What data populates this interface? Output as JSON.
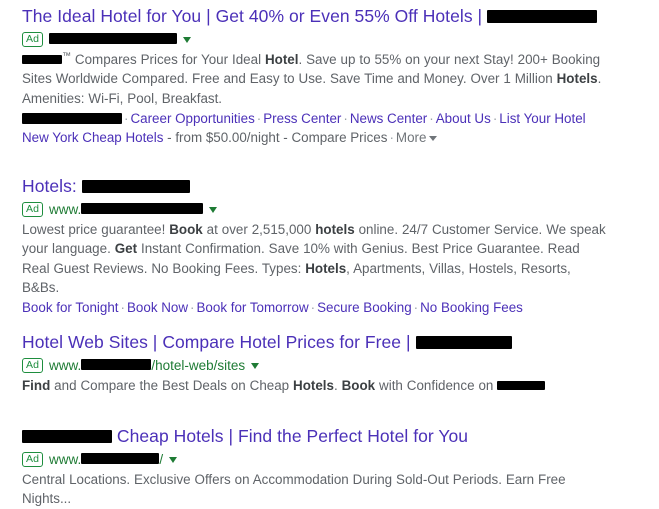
{
  "page": {
    "background": "#ffffff",
    "title_color": "#4b30b8",
    "url_color": "#1e7b34",
    "desc_color": "#5f6368",
    "ad_badge_color": "#1e8e3e",
    "separator_color": "#9aa0a6",
    "redaction_color": "#000000"
  },
  "ads": [
    {
      "badge": "Ad",
      "title_before": "The Ideal Hotel for You | Get 40% or Even 55% Off Hotels | ",
      "title_redacted_width": 110,
      "title_after": "",
      "url_prefix": "",
      "url_redacted_width": 128,
      "url_suffix": "",
      "has_caret": true,
      "desc_redacted_width": 40,
      "desc_trademark": "™",
      "desc_parts": [
        {
          "text": " Compares Prices for Your Ideal ",
          "bold": false
        },
        {
          "text": "Hotel",
          "bold": true
        },
        {
          "text": ". Save up to 55% on your next Stay! 200+ Booking Sites Worldwide Compared. Free and Easy to Use. Save Time and Money. Over 1 Million ",
          "bold": false
        },
        {
          "text": "Hotels",
          "bold": true
        },
        {
          "text": ". Amenities: Wi-Fi, Pool, Breakfast.",
          "bold": false
        }
      ],
      "sitelinks_row1_redacted_width": 100,
      "sitelinks_row1": [
        "Career Opportunities",
        "Press Center",
        "News Center",
        "About Us",
        "List Your Hotel"
      ],
      "sitelinks_row2": {
        "link": "New York Cheap Hotels",
        "plain": " - from $50.00/night - ",
        "gray_link": "Compare Prices",
        "more": "More"
      }
    },
    {
      "badge": "Ad",
      "title_before": "Hotels: ",
      "title_redacted_width": 108,
      "title_after": "",
      "url_prefix": "www.",
      "url_redacted_width": 122,
      "url_suffix": "",
      "has_caret": true,
      "desc_parts": [
        {
          "text": "Lowest price guarantee! ",
          "bold": false
        },
        {
          "text": "Book",
          "bold": true
        },
        {
          "text": " at over 2,515,000 ",
          "bold": false
        },
        {
          "text": "hotels",
          "bold": true
        },
        {
          "text": " online. 24/7 Customer Service. We speak your language. ",
          "bold": false
        },
        {
          "text": "Get",
          "bold": true
        },
        {
          "text": " Instant Confirmation. Save 10% with Genius. Best Price Guarantee. Read Real Guest Reviews. No Booking Fees. Types: ",
          "bold": false
        },
        {
          "text": "Hotels",
          "bold": true
        },
        {
          "text": ", Apartments, Villas, Hostels, Resorts, B&Bs.",
          "bold": false
        }
      ],
      "sitelinks_row1": [
        "Book for Tonight",
        "Book Now",
        "Book for Tomorrow",
        "Secure Booking",
        "No Booking Fees"
      ]
    },
    {
      "badge": "Ad",
      "title_before": "Hotel Web Sites | Compare Hotel Prices for Free | ",
      "title_redacted_width": 96,
      "title_after": "",
      "url_prefix": "www.",
      "url_redacted_width": 70,
      "url_suffix": "/hotel-web/sites",
      "has_caret": true,
      "desc_parts": [
        {
          "text": "Find",
          "bold": true
        },
        {
          "text": " and Compare the Best Deals on Cheap ",
          "bold": false
        },
        {
          "text": "Hotels",
          "bold": true
        },
        {
          "text": ". ",
          "bold": false
        },
        {
          "text": "Book",
          "bold": true
        },
        {
          "text": " with Confidence on ",
          "bold": false
        }
      ],
      "desc_trailing_redacted_width": 48
    },
    {
      "badge": "Ad",
      "title_leading_redacted_width": 90,
      "title_before": " Cheap Hotels | Find the Perfect Hotel for You",
      "title_after": "",
      "url_prefix": "www.",
      "url_redacted_width": 78,
      "url_suffix": "/",
      "has_caret": true,
      "desc_parts": [
        {
          "text": "Central Locations. Exclusive Offers on Accommodation During Sold-Out Periods. Earn Free Nights...",
          "bold": false
        }
      ]
    }
  ]
}
